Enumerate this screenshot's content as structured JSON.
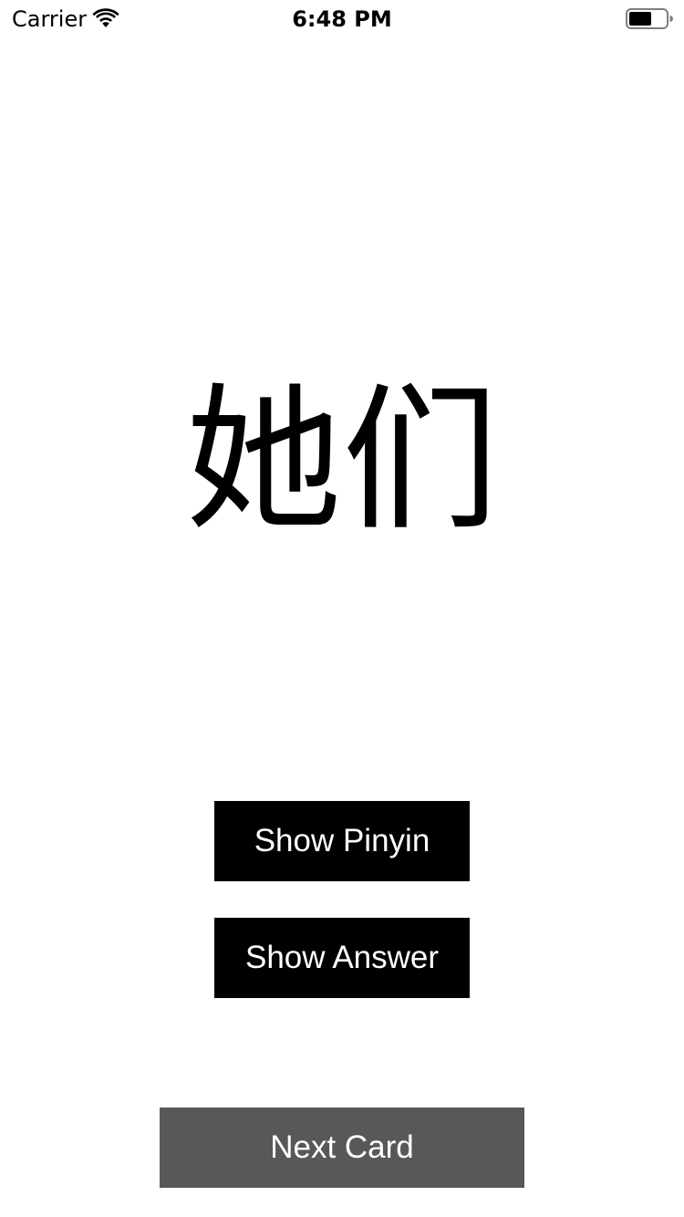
{
  "status_bar": {
    "carrier": "Carrier",
    "time": "6:48 PM",
    "wifi_icon": "wifi-icon",
    "battery_icon": "battery-icon"
  },
  "card": {
    "word": "她们"
  },
  "buttons": {
    "show_pinyin": "Show Pinyin",
    "show_answer": "Show Answer",
    "next_card": "Next Card"
  },
  "colors": {
    "primary_button": "#000000",
    "next_button": "#585858",
    "background": "#ffffff",
    "button_text": "#ffffff"
  }
}
